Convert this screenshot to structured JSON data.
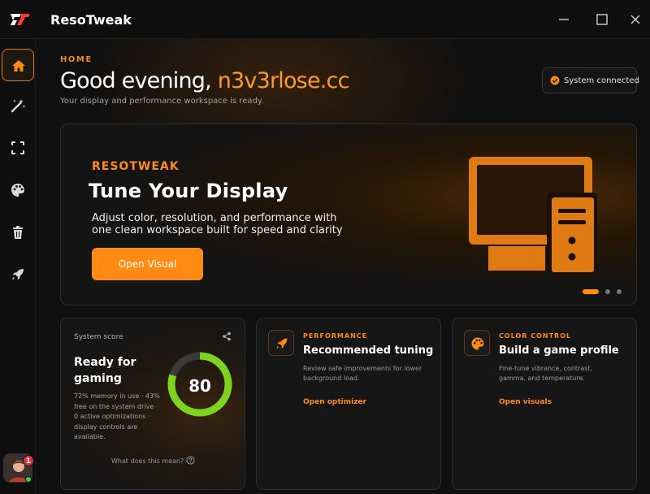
{
  "app": {
    "title": "ResoTweak",
    "logo_icon": "rt-logo-icon",
    "accent": "#ff8a14"
  },
  "window_controls": [
    "minimize-icon",
    "maximize-icon",
    "close-icon"
  ],
  "sidebar": {
    "items": [
      {
        "icon": "home-icon",
        "active": true
      },
      {
        "icon": "magic-wand-icon",
        "active": false
      },
      {
        "icon": "resolution-icon",
        "active": false
      },
      {
        "icon": "palette-icon",
        "active": false
      },
      {
        "icon": "trash-icon",
        "active": false
      },
      {
        "icon": "rocket-icon",
        "active": false
      }
    ],
    "avatar": {
      "badge": "1",
      "online": true
    }
  },
  "header": {
    "eyebrow": "HOME",
    "greeting_prefix": "Good evening, ",
    "username": "n3v3rlose.cc",
    "subtitle": "Your display and performance workspace is ready.",
    "status": {
      "text": "System connected",
      "icon": "check-circle-icon",
      "color": "#f08a1c"
    }
  },
  "hero": {
    "eyebrow": "RESOTWEAK",
    "title": "Tune Your Display",
    "description": "Adjust color, resolution, and performance with one clean workspace built for speed and clarity",
    "button": "Open Visual",
    "art_icon": "desktop-computer-icon",
    "slides": {
      "count": 3,
      "active": 0
    }
  },
  "score_card": {
    "label": "System score",
    "title": "Ready for gaming",
    "description": "72% memory in use · 43% free on the system drive · 0 active optimizations · display controls are available.",
    "value": "80",
    "progress": 0.8,
    "gauge_color": "#7ed321",
    "help": "What does this mean?"
  },
  "tiles": [
    {
      "icon": "rocket-icon",
      "eyebrow": "PERFORMANCE",
      "title": "Recommended tuning",
      "description": "Review safe improvements for lower background load.",
      "link": "Open optimizer"
    },
    {
      "icon": "palette-icon",
      "eyebrow": "COLOR CONTROL",
      "title": "Build a game profile",
      "description": "Fine-tune vibrance, contrast, gamma, and temperature.",
      "link": "Open visuals"
    }
  ]
}
